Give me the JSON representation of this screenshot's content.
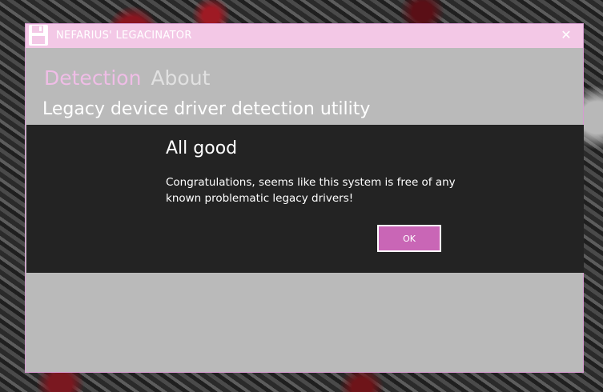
{
  "window": {
    "title": "NEFARIUS' LEGACINATOR",
    "close_glyph": "✕",
    "icon": "floppy-disk-icon"
  },
  "tabs": [
    {
      "label": "Detection",
      "active": true
    },
    {
      "label": "About",
      "active": false
    }
  ],
  "subtitle": "Legacy device driver detection utility",
  "dialog": {
    "title": "All good",
    "message": "Congratulations, seems like this system is free of any known problematic legacy drivers!",
    "ok_label": "OK"
  },
  "colors": {
    "titlebar": "#f3c8e6",
    "accent": "#c966b6",
    "active_tab": "#efbde6",
    "window_bg": "#bababa",
    "dialog_bg": "#232323"
  }
}
